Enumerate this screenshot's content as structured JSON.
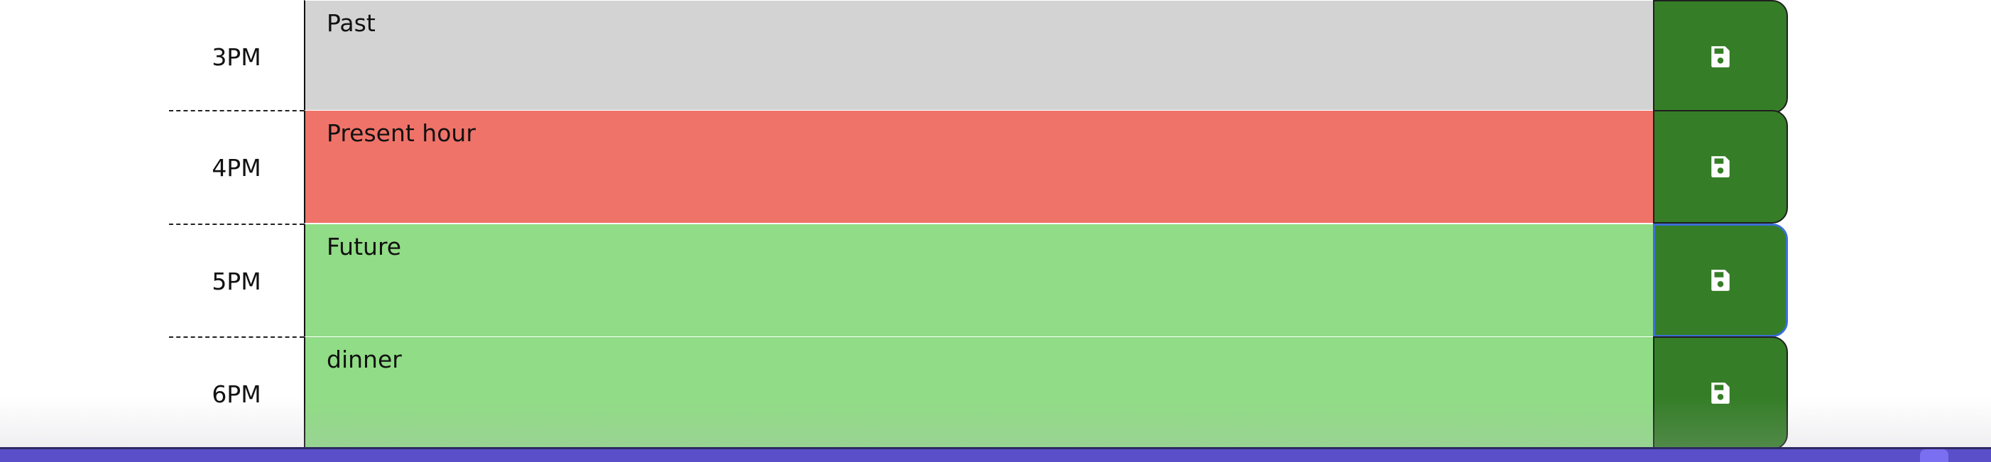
{
  "colors": {
    "past": "#d3d3d3",
    "present": "#ef7369",
    "future": "#91dc86",
    "save_button": "#357e27",
    "focus_ring": "#3b6fd6",
    "dock": "#5b4fc9"
  },
  "rows": [
    {
      "hour": "3PM",
      "text": "Past",
      "state": "past",
      "save_icon": "floppy-disk-icon"
    },
    {
      "hour": "4PM",
      "text": "Present hour",
      "state": "present",
      "save_icon": "floppy-disk-icon"
    },
    {
      "hour": "5PM",
      "text": "Future",
      "state": "future",
      "save_icon": "floppy-disk-icon"
    },
    {
      "hour": "6PM",
      "text": "dinner",
      "state": "future",
      "save_icon": "floppy-disk-icon"
    }
  ]
}
